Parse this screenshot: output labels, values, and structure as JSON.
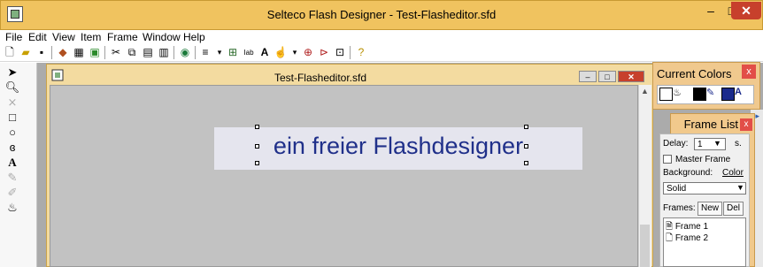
{
  "window": {
    "title": "Selteco Flash Designer - Test-Flasheditor.sfd",
    "min_icon": "–",
    "max_icon": "□",
    "close_icon": "✕"
  },
  "menubar": {
    "items": [
      "File",
      "Edit",
      "View",
      "Item",
      "Frame",
      "Window",
      "Help"
    ]
  },
  "document": {
    "title": "Test-Flasheditor.sfd",
    "stage_text": "ein freier Flashdesigner"
  },
  "current_colors": {
    "title": "Current Colors",
    "close": "x",
    "colors": [
      "#ffffff",
      "#000000",
      "#1a2a8c"
    ]
  },
  "frame_list": {
    "title": "Frame List",
    "close": "x",
    "delay_label": "Delay:",
    "delay_value": "1",
    "delay_unit": "s.",
    "master_frame_label": "Master Frame",
    "background_label": "Background:",
    "color_button": "Color",
    "background_value": "Solid",
    "frames_label": "Frames:",
    "new_button": "New",
    "del_button": "Del",
    "frames": [
      "Frame 1",
      "Frame 2"
    ]
  },
  "colors": {
    "titlebar": "#f0c35f",
    "close_red": "#c7402c",
    "stage_text": "#20308a",
    "canvas": "#c2c2c2"
  }
}
